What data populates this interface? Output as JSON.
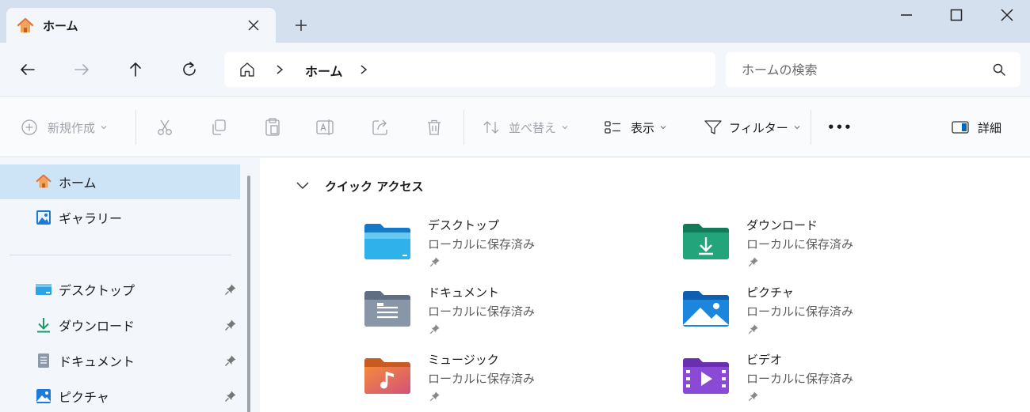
{
  "tab": {
    "title": "ホーム"
  },
  "address": {
    "crumb": "ホーム"
  },
  "search": {
    "placeholder": "ホームの検索"
  },
  "toolbar": {
    "new_label": "新規作成",
    "sort_label": "並べ替え",
    "view_label": "表示",
    "filter_label": "フィルター",
    "more_label": "•••",
    "details_label": "詳細"
  },
  "sidebar": {
    "top": [
      {
        "label": "ホーム"
      },
      {
        "label": "ギャラリー"
      }
    ],
    "pinned": [
      {
        "label": "デスクトップ"
      },
      {
        "label": "ダウンロード"
      },
      {
        "label": "ドキュメント"
      },
      {
        "label": "ピクチャ"
      }
    ]
  },
  "quick_access": {
    "title": "クイック アクセス",
    "items": [
      {
        "name": "デスクトップ",
        "sub": "ローカルに保存済み"
      },
      {
        "name": "ダウンロード",
        "sub": "ローカルに保存済み"
      },
      {
        "name": "ドキュメント",
        "sub": "ローカルに保存済み"
      },
      {
        "name": "ピクチャ",
        "sub": "ローカルに保存済み"
      },
      {
        "name": "ミュージック",
        "sub": "ローカルに保存済み"
      },
      {
        "name": "ビデオ",
        "sub": "ローカルに保存済み"
      }
    ]
  },
  "colors": {
    "accent": "#0067c0",
    "selected": "#cde4f7",
    "chrome": "#d4e0ee"
  }
}
